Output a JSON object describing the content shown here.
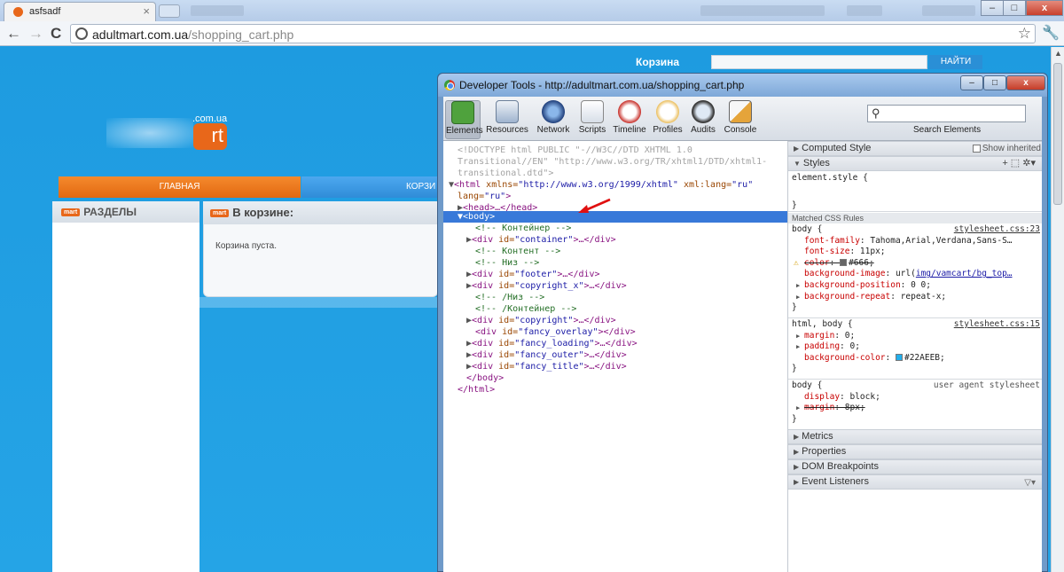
{
  "browser": {
    "tab_title": "asfsadf",
    "tab_close": "×",
    "url_host": "adultmart.com.ua",
    "url_path": "/shopping_cart.php",
    "back": "←",
    "forward": "→",
    "reload": "C",
    "star": "☆",
    "wrench": "🔧",
    "min": "–",
    "max": "□",
    "close": "x"
  },
  "page": {
    "cart_link": "Корзина",
    "search_button": "НАЙТИ",
    "logo_domain": ".com.ua",
    "logo_text": "rt",
    "menu_home": "ГЛАВНАЯ",
    "menu_second": "КОРЗИ",
    "mart_tag": "mart",
    "sections_title": "РАЗДЕЛЫ",
    "cart_title": "В корзине:",
    "cart_empty": "Корзина пуста."
  },
  "devtools": {
    "title": "Developer Tools - http://adultmart.com.ua/shopping_cart.php",
    "panels": [
      "Elements",
      "Resources",
      "Network",
      "Scripts",
      "Timeline",
      "Profiles",
      "Audits",
      "Console"
    ],
    "search_label": "Search Elements",
    "dom": {
      "doctype1": "<!DOCTYPE html PUBLIC \"-//W3C//DTD XHTML 1.0",
      "doctype2": "Transitional//EN\" \"http://www.w3.org/TR/xhtml1/DTD/xhtml1-",
      "doctype3": "transitional.dtd\">",
      "html_open": "<html",
      "html_xmlns": "xmlns=",
      "html_xmlns_val": "\"http://www.w3.org/1999/xhtml\"",
      "html_xmllang": "xml:lang=",
      "html_xmllang_val": "\"ru\"",
      "html_lang": "lang=",
      "html_lang_val": "\"ru\"",
      "html_close_bracket": ">",
      "head": "<head>…</head>",
      "body_open": "<body>",
      "c_container": "<!-- Контейнер -->",
      "div_container_id": "\"container\"",
      "c_content": "<!-- Контент -->",
      "c_bottom": "<!-- Низ -->",
      "div_footer_id": "\"footer\"",
      "div_copyright_x_id": "\"copyright_x\"",
      "c_bottom_end": "<!-- /Низ -->",
      "c_container_end": "<!-- /Контейнер -->",
      "div_copyright_id": "\"copyright\"",
      "div_fancy_overlay_id": "\"fancy_overlay\"",
      "div_fancy_loading_id": "\"fancy_loading\"",
      "div_fancy_outer_id": "\"fancy_outer\"",
      "div_fancy_title_id": "\"fancy_title\"",
      "div_open": "<div",
      "id_attr": "id=",
      "gt_ellipsis": ">…</div>",
      "gt_empty": "></div>",
      "body_close": "</body>",
      "html_close": "</html>"
    },
    "side": {
      "computed_style": "Computed Style",
      "show_inherited": "Show inherited",
      "styles": "Styles",
      "styles_tools": "+ ⬚ ✲▾",
      "element_style": "element.style {",
      "close_brace": "}",
      "matched_rules": "Matched CSS Rules",
      "rule1_selector": "body {",
      "rule1_source": "stylesheet.css:23",
      "rule1_font_family_name": "font-family",
      "rule1_font_family_val": ": Tahoma,Arial,Verdana,Sans-S…",
      "rule1_font_size_name": "font-size",
      "rule1_font_size_val": ": 11px;",
      "rule1_color_name": "color",
      "rule1_color_val": "#666;",
      "rule1_bgimg_name": "background-image",
      "rule1_bgimg_pre": ": url(",
      "rule1_bgimg_link": "img/vamcart/bg_top…",
      "rule1_bgpos_name": "background-position",
      "rule1_bgpos_val": ": 0 0;",
      "rule1_bgrep_name": "background-repeat",
      "rule1_bgrep_val": ": repeat-x;",
      "rule2_selector": "html, body {",
      "rule2_source": "stylesheet.css:15",
      "rule2_margin_name": "margin",
      "rule2_margin_val": ": 0;",
      "rule2_padding_name": "padding",
      "rule2_padding_val": ": 0;",
      "rule2_bgcolor_name": "background-color",
      "rule2_bgcolor_val": "#22AEEB;",
      "rule3_selector": "body {",
      "rule3_source": "user agent stylesheet",
      "rule3_display_name": "display",
      "rule3_display_val": ": block;",
      "rule3_margin_name": "margin",
      "rule3_margin_val": ": 8px;",
      "metrics": "Metrics",
      "properties": "Properties",
      "dom_breakpoints": "DOM Breakpoints",
      "event_listeners": "Event Listeners"
    }
  },
  "colors": {
    "page_bg": "#1e9be0",
    "accent_orange": "#e8671a",
    "swatch_gray": "#666666",
    "swatch_blue": "#22AEEB",
    "selection": "#3879d9"
  }
}
